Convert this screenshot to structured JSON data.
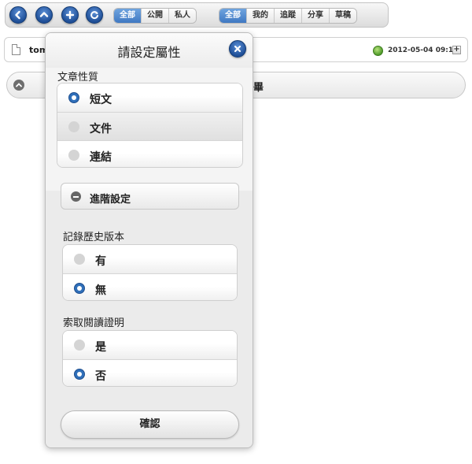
{
  "toolbar": {
    "round_buttons": [
      "back-icon",
      "up-icon",
      "add-icon",
      "refresh-icon"
    ],
    "visibility_tabs": [
      {
        "label": "全部",
        "active": true
      },
      {
        "label": "公開",
        "active": false
      },
      {
        "label": "私人",
        "active": false
      }
    ],
    "category_tabs": [
      {
        "label": "全部",
        "active": true
      },
      {
        "label": "我的",
        "active": false
      },
      {
        "label": "追蹤",
        "active": false
      },
      {
        "label": "分享",
        "active": false
      },
      {
        "label": "草稿",
        "active": false
      }
    ]
  },
  "post": {
    "author": "tom",
    "datetime": "2012-05-04 09:15"
  },
  "collapsed_row": {
    "trailing_text": "畢"
  },
  "dialog": {
    "title": "請設定屬性",
    "article_type": {
      "label": "文章性質",
      "options": [
        "短文",
        "文件",
        "連結"
      ],
      "selected": "短文"
    },
    "advanced_label": "進階設定",
    "history": {
      "label": "記錄歷史版本",
      "options": [
        "有",
        "無"
      ],
      "selected": "無"
    },
    "read_receipt": {
      "label": "索取閱讀證明",
      "options": [
        "是",
        "否"
      ],
      "selected": "否"
    },
    "confirm_label": "確認"
  },
  "colors": {
    "accent": "#2f6fb9",
    "tab_active": "#4f86cc"
  }
}
